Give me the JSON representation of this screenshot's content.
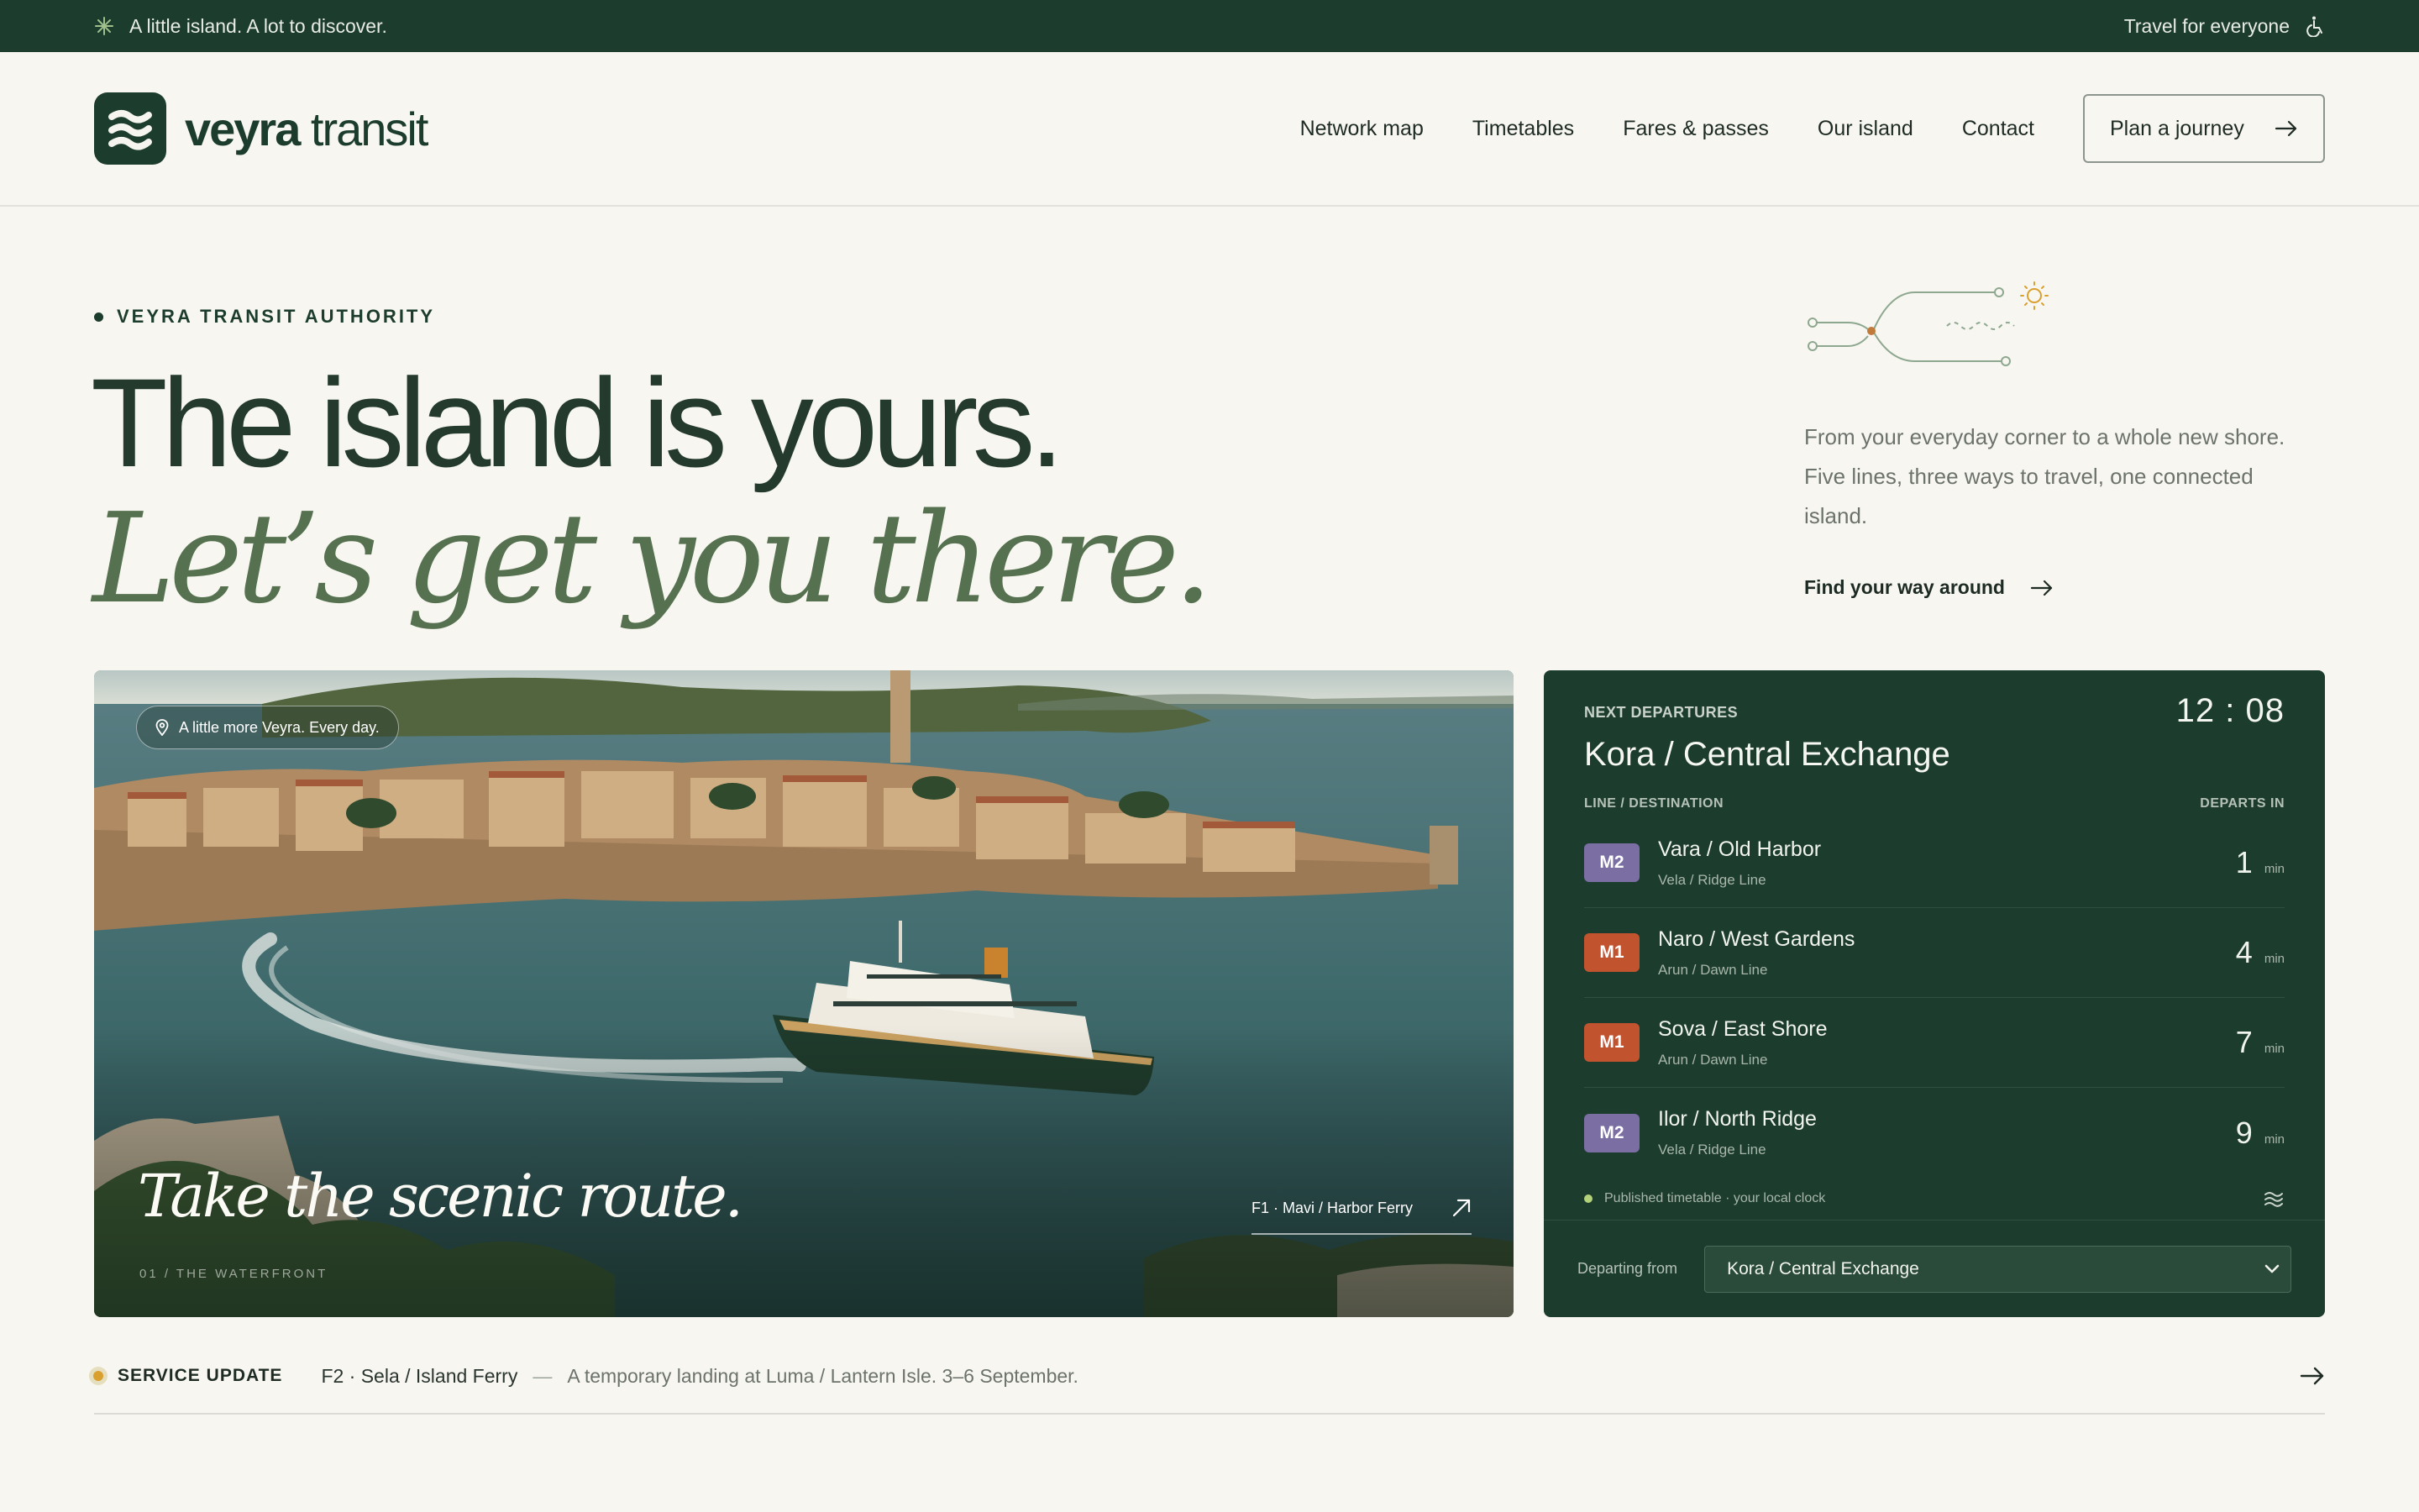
{
  "topbar": {
    "tagline": "A little island. A lot to discover.",
    "accessibility": "Travel for everyone"
  },
  "brand": {
    "name_bold": "veyra",
    "name_light": " transit"
  },
  "nav": {
    "items": [
      "Network map",
      "Timetables",
      "Fares & passes",
      "Our island",
      "Contact"
    ],
    "cta": "Plan a journey"
  },
  "hero": {
    "eyebrow": "VEYRA TRANSIT AUTHORITY",
    "headline": "The island is yours.",
    "headline_italic": "Let’s get you there.",
    "intro": "From your everyday corner to a whole new shore. Five lines, three ways to travel, one connected island.",
    "link": "Find your way around"
  },
  "image": {
    "pill": "A little more Veyra. Every day.",
    "title": "Take the scenic route.",
    "caption": "01 / THE WATERFRONT",
    "route": "F1 · Mavi / Harbor Ferry"
  },
  "departures": {
    "eyebrow": "NEXT DEPARTURES",
    "clock": "12 : 08",
    "station": "Kora / Central Exchange",
    "col_line": "LINE / DESTINATION",
    "col_departs": "DEPARTS IN",
    "rows": [
      {
        "badge": "M2",
        "color": "#7a6ea3",
        "destination": "Vara / Old Harbor",
        "line": "Vela / Ridge Line",
        "minutes": "1",
        "unit": "min"
      },
      {
        "badge": "M1",
        "color": "#c2532f",
        "destination": "Naro / West Gardens",
        "line": "Arun / Dawn Line",
        "minutes": "4",
        "unit": "min"
      },
      {
        "badge": "M1",
        "color": "#c2532f",
        "destination": "Sova / East Shore",
        "line": "Arun / Dawn Line",
        "minutes": "7",
        "unit": "min"
      },
      {
        "badge": "M2",
        "color": "#7a6ea3",
        "destination": "Ilor / North Ridge",
        "line": "Vela / Ridge Line",
        "minutes": "9",
        "unit": "min"
      }
    ],
    "note": "Published timetable · your local clock",
    "from_label": "Departing from",
    "from_value": "Kora / Central Exchange"
  },
  "service": {
    "label": "SERVICE UPDATE",
    "route": "F2 · Sela / Island Ferry",
    "dash": "—",
    "message": "A temporary landing at Luma / Lantern Isle. 3–6 September."
  },
  "colors": {
    "brand_green": "#1c3c2e",
    "accent_sage": "#55714f",
    "m1": "#c2532f",
    "m2": "#7a6ea3",
    "service_dot": "#d9a030"
  },
  "icons": {
    "tagline": "sparkle-icon",
    "accessibility": "wheelchair-icon",
    "cta": "arrow-right-icon",
    "pill": "location-pin-icon",
    "route": "arrow-up-right-icon",
    "note": "wave-lines-icon",
    "select": "chevron-down-icon"
  }
}
